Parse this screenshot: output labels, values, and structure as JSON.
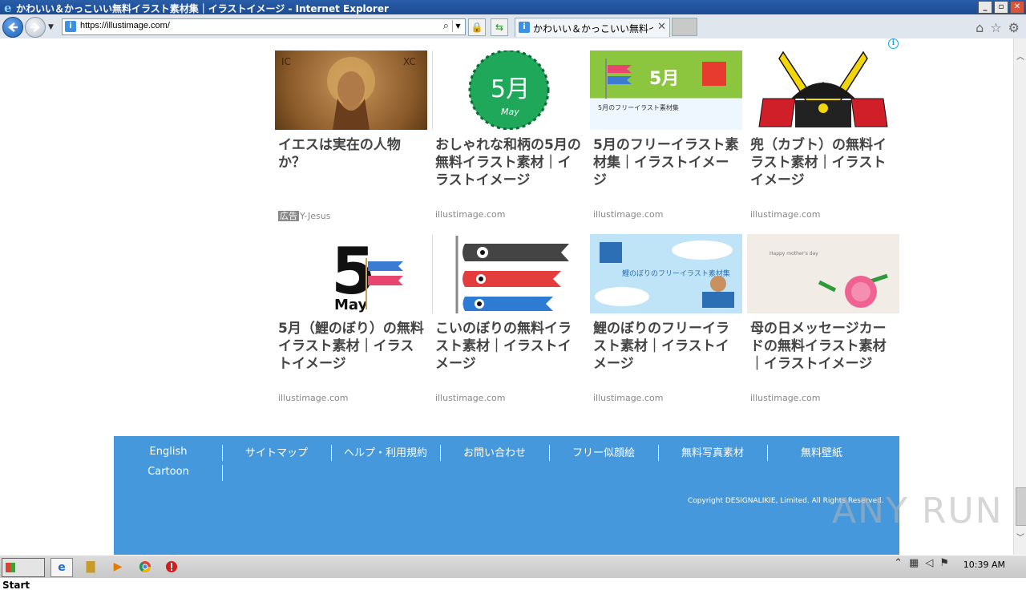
{
  "window": {
    "title": "かわいい＆かっこいい無料イラスト素材集｜イラストイメージ - Internet Explorer",
    "controls": [
      "_",
      "▫",
      "✕"
    ]
  },
  "browser": {
    "url": "https://illustimage.com/",
    "tab_title": "かわいい＆かっこいい無料イラ...",
    "tab_close": "✕",
    "favicon_text": "i"
  },
  "cards": [
    {
      "title": "イエスは実在の人物か？",
      "ad_tag": "広告",
      "source": "Y-Jesus",
      "thumb": "jesus-mosaic-image",
      "thumb_text": ""
    },
    {
      "title": "おしゃれな和柄の5月の無料イラスト素材｜イラストイメージ",
      "ad_tag": "",
      "source": "illustimage.com",
      "thumb": "may-wagara-image",
      "thumb_text": "5月"
    },
    {
      "title": "5月のフリーイラスト素材集｜イラストイメージ",
      "ad_tag": "",
      "source": "illustimage.com",
      "thumb": "may-koinobori-banner-image",
      "thumb_text": "5月"
    },
    {
      "title": "兜（カブト）の無料イラスト素材｜イラストイメージ",
      "ad_tag": "",
      "source": "illustimage.com",
      "thumb": "kabuto-helmet-image",
      "thumb_text": ""
    },
    {
      "title": "5月（鯉のぼり）の無料イラスト素材｜イラストイメージ",
      "ad_tag": "",
      "source": "illustimage.com",
      "thumb": "may-5-calendar-image",
      "thumb_text": "5"
    },
    {
      "title": "こいのぼりの無料イラスト素材｜イラストイメージ",
      "ad_tag": "",
      "source": "illustimage.com",
      "thumb": "koinobori-carp-image",
      "thumb_text": ""
    },
    {
      "title": "鯉のぼりのフリーイラスト素材｜イラストイメージ",
      "ad_tag": "",
      "source": "illustimage.com",
      "thumb": "koinobori-card-image",
      "thumb_text": "鯉のぼりのフリーイラスト素材集"
    },
    {
      "title": "母の日メッセージカードの無料イラスト素材｜イラストイメージ",
      "ad_tag": "",
      "source": "illustimage.com",
      "thumb": "mothers-day-card-image",
      "thumb_text": "Happy mother's day"
    }
  ],
  "may_label": "May",
  "ad_info_icon": "i",
  "footer": {
    "links": [
      "English",
      "サイトマップ",
      "ヘルプ・利用規約",
      "お問い合わせ",
      "フリー似顔絵",
      "無料写真素材",
      "無料壁紙",
      "Cartoon"
    ],
    "copyright": "Copyright DESIGNALIKIE, Limited. All Rights Reserved."
  },
  "watermark": "ANY RUN",
  "taskbar": {
    "start_label": "Start",
    "clock": "10:39 AM"
  }
}
